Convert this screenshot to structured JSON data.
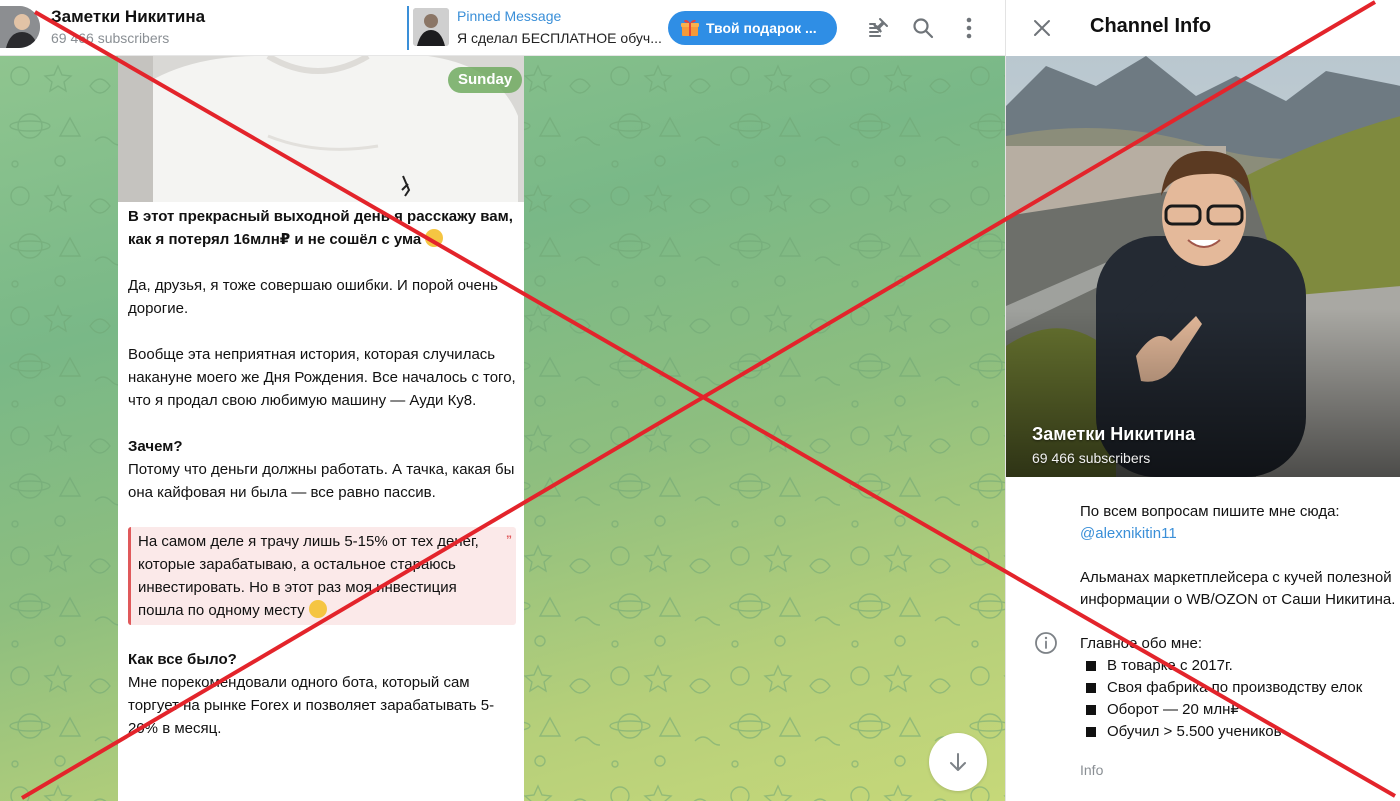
{
  "header": {
    "channel_title": "Заметки Никитина",
    "subscribers": "69 466 subscribers",
    "pinned_title": "Pinned Message",
    "pinned_text": "Я сделал БЕСПЛАТНОЕ обуч...",
    "gift_label": "Твой подарок ...",
    "icons": [
      "pinned-list-icon",
      "search-icon",
      "more-vertical-icon"
    ]
  },
  "message": {
    "date": "Sunday",
    "heading": "В этот прекрасный выходной день я расскажу вам, как я потерял 16млн₽ и не сошёл с ума",
    "p1": "Да, друзья, я тоже совершаю ошибки. И порой очень дорогие.",
    "p2": "Вообще эта неприятная история, которая случилась накануне моего же Дня Рождения. Все началось с того, что я продал свою любимую машину — Ауди Ку8.",
    "why_heading": "Зачем?",
    "why_text": "Потому что деньги должны работать. А тачка, какая бы она кайфовая ни была — все равно пассив.",
    "quote": "На самом деле я трачу лишь 5-15% от тех денег, которые зарабатываю, а остальное стараюсь инвестировать. Но в этот раз моя инвестиция пошла по одному месту",
    "quote_mark": "”",
    "how_heading": "Как все было?",
    "how_text": "Мне порекомендовали одного бота, который сам торгует на рынке Forex и позволяет зарабатывать 5-20% в месяц."
  },
  "side_panel": {
    "title": "Channel Info",
    "cover_name": "Заметки Никитина",
    "cover_subscribers": "69 466 subscribers",
    "contact_text": "По всем вопросам пишите мне сюда:",
    "contact_link": "@alexnikitin11",
    "description": "Альманах маркетплейсера с кучей полезной информации о WB/OZON от Саши Никитина.",
    "main_heading": "Главное обо мне:",
    "bullets": [
      "В товарке с 2017г.",
      "Своя фабрика по производству елок",
      "Оборот — 20 млн₽",
      "Обучил > 5.500 учеников"
    ],
    "info_label": "Info"
  },
  "colors": {
    "accent": "#3a8fd8",
    "gift_button": "#2f8ee5",
    "quote_border": "#e0595b",
    "cross": "#e3242b"
  }
}
